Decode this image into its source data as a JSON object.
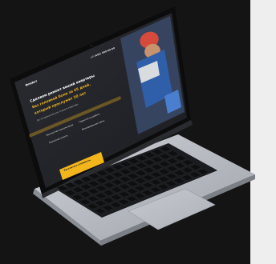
{
  "page": {
    "background_color": "#141414",
    "right_panel_color": "#eeeeee"
  },
  "device": {
    "type": "laptop",
    "body_color": "#b8bcc4",
    "keyboard_color": "#1b1c1f",
    "screen_bezel_color": "#0c0c0d"
  },
  "website": {
    "logo": "Флайкт",
    "phone": "+7 (495) 000-00-00",
    "headline_line1": "Сделаем ремонт вашей квартиры",
    "headline_line2": "без головной боли за 45 дней,",
    "headline_line3": "который прослужит 20 лет",
    "subtitle": "До 15 вариантов для отделки квартиры",
    "feature1": "Бесплатная консультация",
    "feature2": "Гарантия на работы",
    "feature3": "Поэтапная оплата",
    "feature4": "Фиксированная смета",
    "cta_label": "Рассчитать стоимость",
    "accent_color": "#f2b51c",
    "hero_bg_color": "#23252b"
  }
}
